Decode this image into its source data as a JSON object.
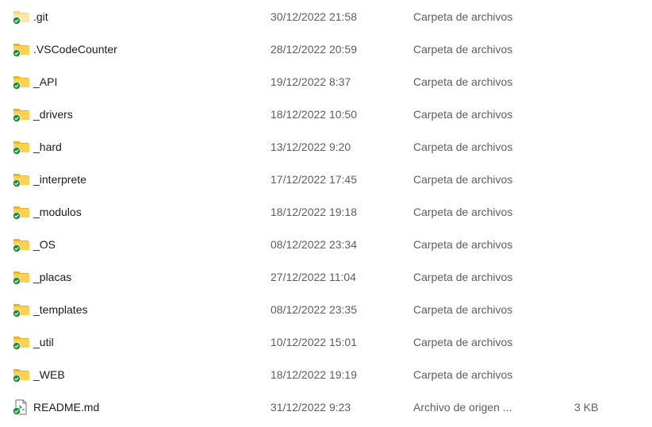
{
  "files": [
    {
      "name": ".git",
      "modified": "30/12/2022 21:58",
      "type": "Carpeta de archivos",
      "size": "",
      "kind": "folder",
      "icon": "folder-icon",
      "faded": true,
      "sync_status": "synced"
    },
    {
      "name": ".VSCodeCounter",
      "modified": "28/12/2022 20:59",
      "type": "Carpeta de archivos",
      "size": "",
      "kind": "folder",
      "icon": "folder-icon",
      "faded": false,
      "sync_status": "synced"
    },
    {
      "name": "_API",
      "modified": "19/12/2022 8:37",
      "type": "Carpeta de archivos",
      "size": "",
      "kind": "folder",
      "icon": "folder-icon",
      "faded": false,
      "sync_status": "synced"
    },
    {
      "name": "_drivers",
      "modified": "18/12/2022 10:50",
      "type": "Carpeta de archivos",
      "size": "",
      "kind": "folder",
      "icon": "folder-icon",
      "faded": false,
      "sync_status": "synced"
    },
    {
      "name": "_hard",
      "modified": "13/12/2022 9:20",
      "type": "Carpeta de archivos",
      "size": "",
      "kind": "folder",
      "icon": "folder-icon",
      "faded": false,
      "sync_status": "synced"
    },
    {
      "name": "_interprete",
      "modified": "17/12/2022 17:45",
      "type": "Carpeta de archivos",
      "size": "",
      "kind": "folder",
      "icon": "folder-icon",
      "faded": false,
      "sync_status": "synced"
    },
    {
      "name": "_modulos",
      "modified": "18/12/2022 19:18",
      "type": "Carpeta de archivos",
      "size": "",
      "kind": "folder",
      "icon": "folder-icon",
      "faded": false,
      "sync_status": "synced"
    },
    {
      "name": "_OS",
      "modified": "08/12/2022 23:34",
      "type": "Carpeta de archivos",
      "size": "",
      "kind": "folder",
      "icon": "folder-icon",
      "faded": false,
      "sync_status": "synced"
    },
    {
      "name": "_placas",
      "modified": "27/12/2022 11:04",
      "type": "Carpeta de archivos",
      "size": "",
      "kind": "folder",
      "icon": "folder-icon",
      "faded": false,
      "sync_status": "synced"
    },
    {
      "name": "_templates",
      "modified": "08/12/2022 23:35",
      "type": "Carpeta de archivos",
      "size": "",
      "kind": "folder",
      "icon": "folder-icon",
      "faded": false,
      "sync_status": "synced"
    },
    {
      "name": "_util",
      "modified": "10/12/2022 15:01",
      "type": "Carpeta de archivos",
      "size": "",
      "kind": "folder",
      "icon": "folder-icon",
      "faded": false,
      "sync_status": "synced"
    },
    {
      "name": "_WEB",
      "modified": "18/12/2022 19:19",
      "type": "Carpeta de archivos",
      "size": "",
      "kind": "folder",
      "icon": "folder-icon",
      "faded": false,
      "sync_status": "synced"
    },
    {
      "name": "README.md",
      "modified": "31/12/2022 9:23",
      "type": "Archivo de origen ...",
      "size": "3 KB",
      "kind": "file",
      "icon": "markdown-file-icon",
      "faded": false,
      "sync_status": "synced"
    }
  ],
  "colors": {
    "folder_back": "#e8b41f",
    "folder_front": "#ffd152",
    "folder_faded_back": "#f1d68a",
    "folder_faded_front": "#fbe7ad",
    "sync_green": "#1e8a3a",
    "meta_text": "#5d5d5d",
    "name_text": "#1a1a1a"
  }
}
